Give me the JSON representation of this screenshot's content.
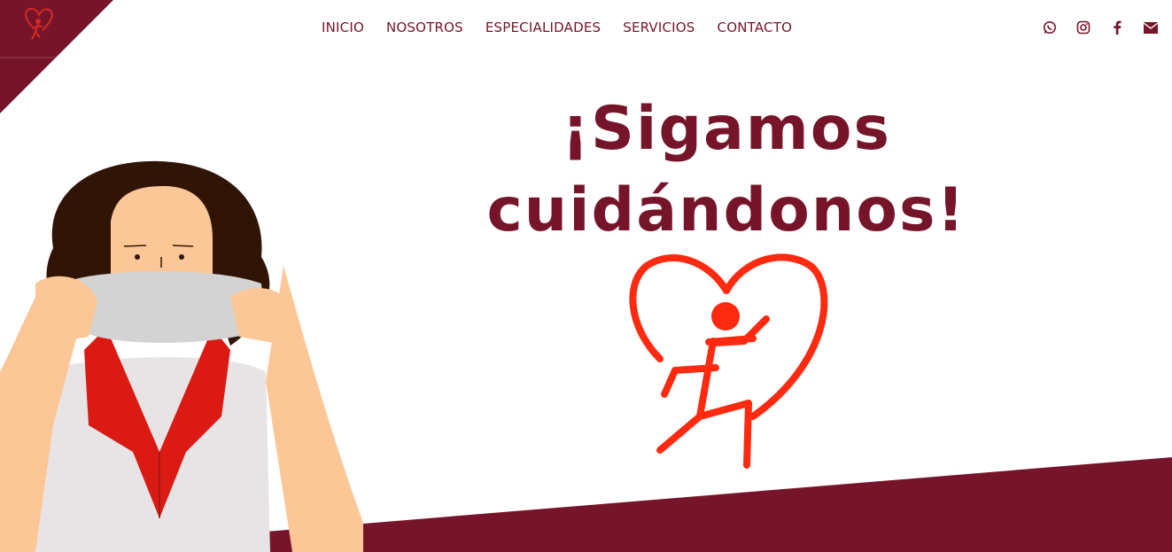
{
  "nav": {
    "items": [
      {
        "label": "INICIO"
      },
      {
        "label": "NOSOTROS"
      },
      {
        "label": "ESPECIALIDADES"
      },
      {
        "label": "SERVICIOS"
      },
      {
        "label": "CONTACTO"
      }
    ]
  },
  "social": [
    "whatsapp-icon",
    "instagram-icon",
    "facebook-icon",
    "envelope-icon"
  ],
  "hero": {
    "line1": "¡Sigamos",
    "line2": "cuidándonos!"
  },
  "colors": {
    "brand": "#76152a",
    "accent": "#ff2a0f"
  }
}
